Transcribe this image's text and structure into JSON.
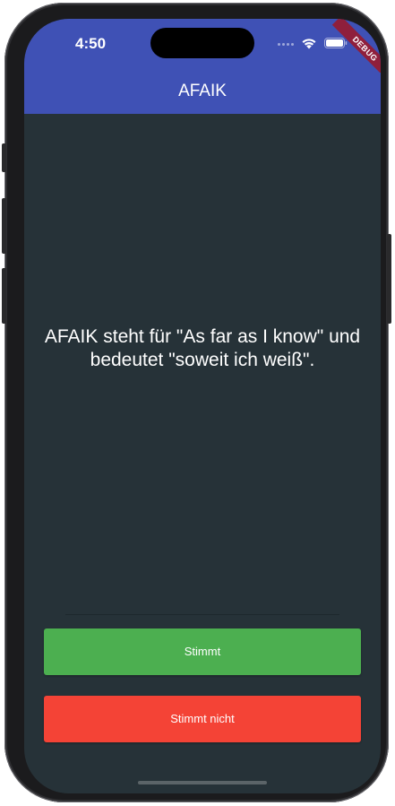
{
  "status_bar": {
    "time": "4:50"
  },
  "debug_banner": "DEBUG",
  "app_bar": {
    "title": "AFAIK"
  },
  "content": {
    "statement": "AFAIK steht für \"As far as I know\" und bedeutet \"soweit ich weiß\"."
  },
  "actions": {
    "agree_label": "Stimmt",
    "disagree_label": "Stimmt nicht"
  },
  "colors": {
    "app_bar": "#3f51b5",
    "background": "#263238",
    "agree": "#4caf50",
    "disagree": "#f44336",
    "debug_ribbon": "#8f1f3c"
  },
  "icons": [
    "signal-icon",
    "wifi-icon",
    "battery-icon"
  ]
}
